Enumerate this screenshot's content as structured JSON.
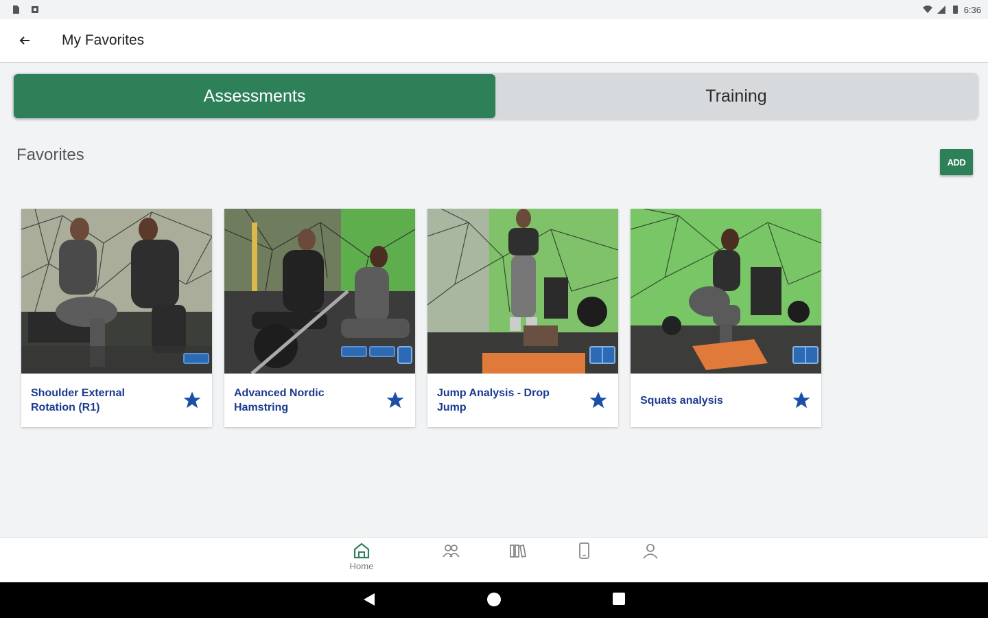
{
  "status_bar": {
    "time": "6:36"
  },
  "app_bar": {
    "title": "My Favorites"
  },
  "tabs": [
    {
      "label": "Assessments",
      "active": true
    },
    {
      "label": "Training",
      "active": false
    }
  ],
  "section": {
    "title": "Favorites",
    "add_label": "ADD"
  },
  "cards": [
    {
      "title": "Shoulder External Rotation (R1)",
      "favorited": true,
      "devices": [
        "flat"
      ]
    },
    {
      "title": "Advanced Nordic Hamstring",
      "favorited": true,
      "devices": [
        "flat",
        "flat",
        "tall"
      ]
    },
    {
      "title": "Jump Analysis - Drop Jump",
      "favorited": true,
      "devices": [
        "book"
      ]
    },
    {
      "title": "Squats analysis",
      "favorited": true,
      "devices": [
        "book"
      ]
    }
  ],
  "bottom_nav": [
    {
      "label": "Home",
      "icon": "home-icon",
      "active": true
    },
    {
      "label": "",
      "icon": "group-icon",
      "active": false
    },
    {
      "label": "",
      "icon": "library-icon",
      "active": false
    },
    {
      "label": "",
      "icon": "device-icon",
      "active": false
    },
    {
      "label": "",
      "icon": "profile-icon",
      "active": false
    }
  ],
  "colors": {
    "primary": "#2e8059",
    "link": "#1a3a8f",
    "star": "#1b4fa8"
  }
}
